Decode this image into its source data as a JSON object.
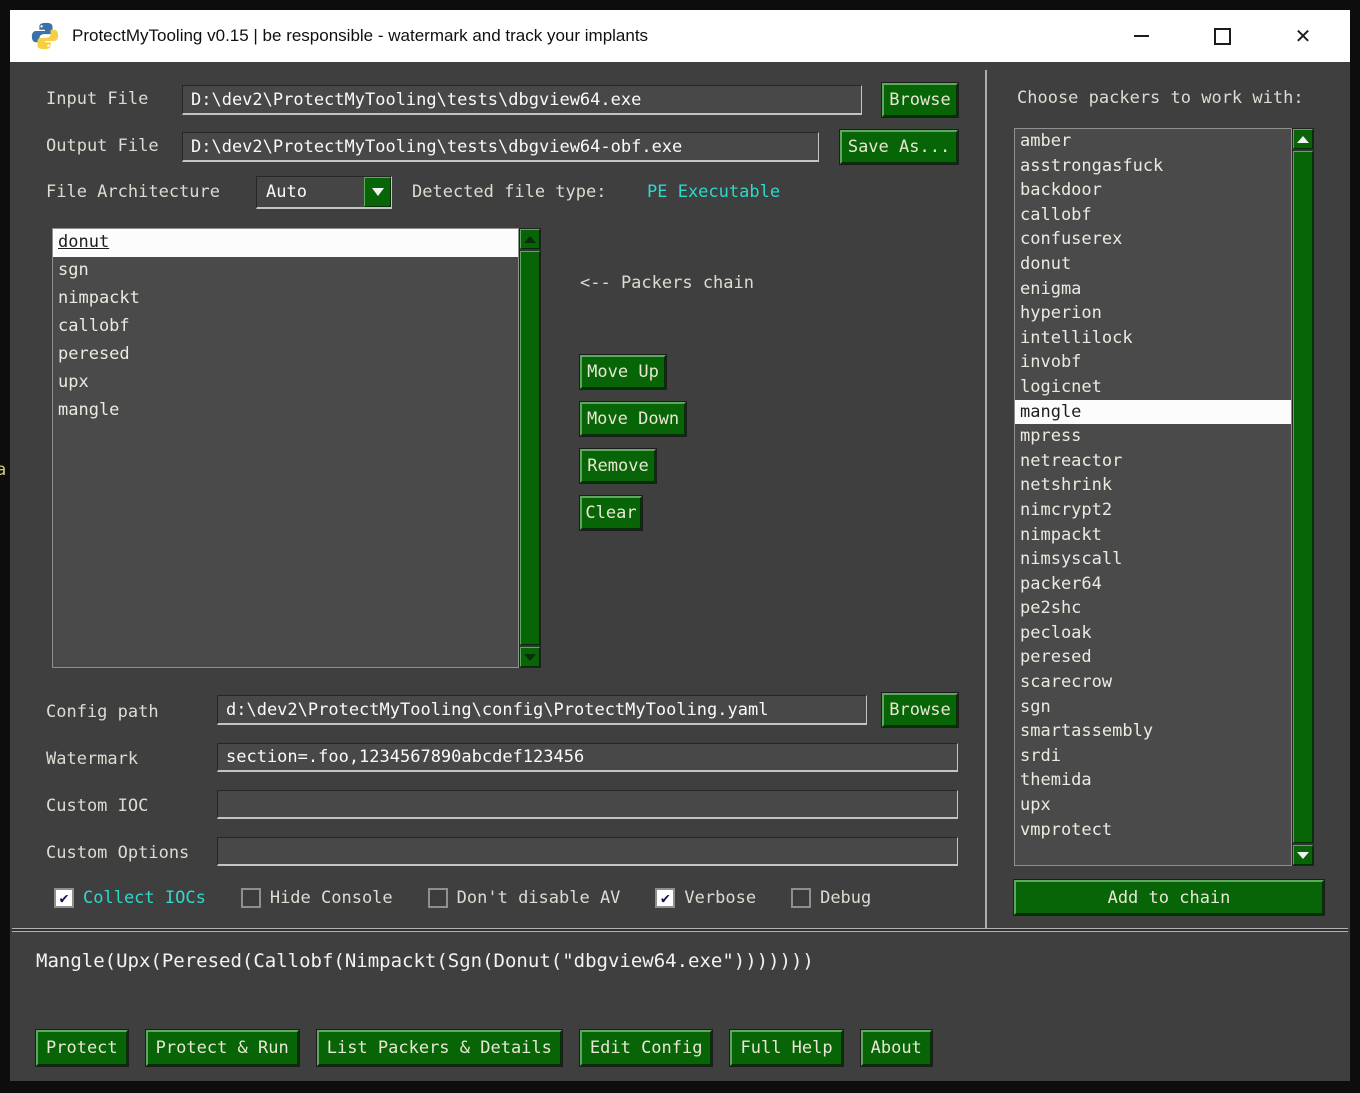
{
  "window": {
    "title": "ProtectMyTooling v0.15 | be responsible - watermark and track your implants"
  },
  "icons": {
    "app_icon": "python-logo",
    "close_glyph": "✕",
    "check_glyph": "✔"
  },
  "colors": {
    "titlebar_bg": "#ffffff",
    "content_bg": "#3f3f3f",
    "button_green": "#076407",
    "cyan_accent": "#2bd9cd",
    "selection_bg": "#fcfcfc"
  },
  "form": {
    "input_file": {
      "label": "Input File",
      "value": "D:\\dev2\\ProtectMyTooling\\tests\\dbgview64.exe",
      "browse_label": "Browse"
    },
    "output_file": {
      "label": "Output File",
      "value": "D:\\dev2\\ProtectMyTooling\\tests\\dbgview64-obf.exe",
      "save_as_label": "Save As..."
    },
    "file_architecture": {
      "label": "File Architecture",
      "value": "Auto"
    },
    "detected_file_type": {
      "label": "Detected file type:",
      "value": "PE Executable"
    },
    "config_path": {
      "label": "Config path",
      "value": "d:\\dev2\\ProtectMyTooling\\config\\ProtectMyTooling.yaml",
      "browse_label": "Browse"
    },
    "watermark": {
      "label": "Watermark",
      "value": "section=.foo,1234567890abcdef123456"
    },
    "custom_ioc": {
      "label": "Custom IOC",
      "value": ""
    },
    "custom_options": {
      "label": "Custom Options",
      "value": ""
    }
  },
  "chain": {
    "hint": "<-- Packers chain",
    "items": [
      "donut",
      "sgn",
      "nimpackt",
      "callobf",
      "peresed",
      "upx",
      "mangle"
    ],
    "selected": "donut",
    "buttons": {
      "move_up": "Move Up",
      "move_down": "Move Down",
      "remove": "Remove",
      "clear": "Clear"
    }
  },
  "packers": {
    "heading": "Choose packers to work with:",
    "items": [
      "amber",
      "asstrongasfuck",
      "backdoor",
      "callobf",
      "confuserex",
      "donut",
      "enigma",
      "hyperion",
      "intellilock",
      "invobf",
      "logicnet",
      "mangle",
      "mpress",
      "netreactor",
      "netshrink",
      "nimcrypt2",
      "nimpackt",
      "nimsyscall",
      "packer64",
      "pe2shc",
      "pecloak",
      "peresed",
      "scarecrow",
      "sgn",
      "smartassembly",
      "srdi",
      "themida",
      "upx",
      "vmprotect"
    ],
    "selected": "mangle",
    "add_button": "Add to chain"
  },
  "options": {
    "checkboxes": [
      {
        "label": "Collect IOCs",
        "checked": true,
        "highlight": true
      },
      {
        "label": "Hide Console",
        "checked": false,
        "highlight": false
      },
      {
        "label": "Don't disable AV",
        "checked": false,
        "highlight": false
      },
      {
        "label": "Verbose",
        "checked": true,
        "highlight": false
      },
      {
        "label": "Debug",
        "checked": false,
        "highlight": false
      }
    ]
  },
  "preview": {
    "expression": "Mangle(Upx(Peresed(Callobf(Nimpackt(Sgn(Donut(\"dbgview64.exe\")))))))"
  },
  "actions": [
    "Protect",
    "Protect & Run",
    "List Packers & Details",
    "Edit Config",
    "Full Help",
    "About"
  ],
  "edge_artifact": "a"
}
